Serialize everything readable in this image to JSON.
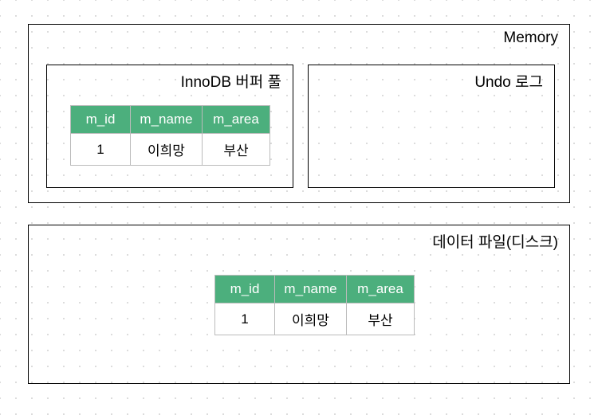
{
  "memory": {
    "title": "Memory",
    "buffer_pool": {
      "title": "InnoDB 버퍼 풀",
      "columns": {
        "id": "m_id",
        "name": "m_name",
        "area": "m_area"
      },
      "row": {
        "id": "1",
        "name": "이희망",
        "area": "부산"
      }
    },
    "undo_log": {
      "title": "Undo 로그"
    }
  },
  "disk": {
    "title": "데이터 파일(디스크)",
    "columns": {
      "id": "m_id",
      "name": "m_name",
      "area": "m_area"
    },
    "row": {
      "id": "1",
      "name": "이희망",
      "area": "부산"
    }
  }
}
